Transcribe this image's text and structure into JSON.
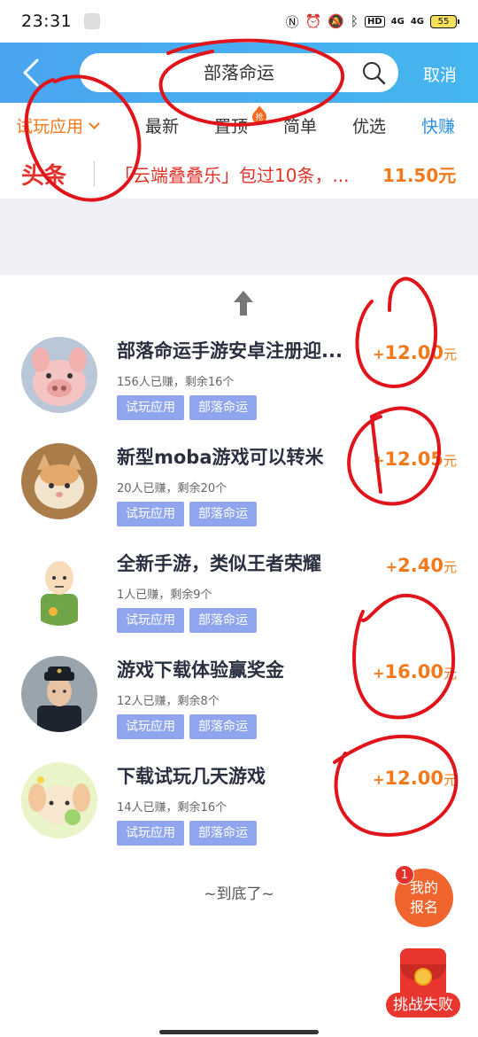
{
  "status_bar": {
    "time": "23:31",
    "hd_label": "HD",
    "net1": "4G",
    "net2": "4G",
    "battery": "55"
  },
  "header": {
    "search_text": "部落命运",
    "cancel_label": "取消"
  },
  "tabs": [
    {
      "label": "试玩应用",
      "active": true
    },
    {
      "label": "最新"
    },
    {
      "label": "置顶"
    },
    {
      "label": "简单"
    },
    {
      "label": "优选"
    },
    {
      "label": "快赚"
    }
  ],
  "hot_badge": "抢",
  "headline": {
    "logo": "头条",
    "text": "「云端叠叠乐」包过10条，...",
    "price": "11.50元"
  },
  "tasks": [
    {
      "title": "部落命运手游安卓注册迎...",
      "meta": "156人已赚，剩余16个",
      "tags": [
        "试玩应用",
        "部落命运"
      ],
      "reward_plus": "+",
      "reward_amount": "12.00",
      "reward_unit": "元"
    },
    {
      "title": "新型moba游戏可以转米",
      "meta": "20人已赚，剩余20个",
      "tags": [
        "试玩应用",
        "部落命运"
      ],
      "reward_plus": "+",
      "reward_amount": "12.05",
      "reward_unit": "元"
    },
    {
      "title": "全新手游，类似王者荣耀",
      "meta": "1人已赚，剩余9个",
      "tags": [
        "试玩应用",
        "部落命运"
      ],
      "reward_plus": "+",
      "reward_amount": "2.40",
      "reward_unit": "元"
    },
    {
      "title": "游戏下载体验赢奖金",
      "meta": "12人已赚，剩余8个",
      "tags": [
        "试玩应用",
        "部落命运"
      ],
      "reward_plus": "+",
      "reward_amount": "16.00",
      "reward_unit": "元"
    },
    {
      "title": "下载试玩几天游戏",
      "meta": "14人已赚，剩余16个",
      "tags": [
        "试玩应用",
        "部落命运"
      ],
      "reward_plus": "+",
      "reward_amount": "12.00",
      "reward_unit": "元"
    }
  ],
  "end_text": "~到底了~",
  "signup": {
    "count": "1",
    "label_line1": "我的",
    "label_line2": "报名"
  },
  "challenge_label": "挑战失败",
  "colors": {
    "accent": "#f07a1c",
    "header_blue": "#4aa4f0",
    "tag_blue": "#8fa6ee",
    "annotation_red": "#e0141b"
  }
}
